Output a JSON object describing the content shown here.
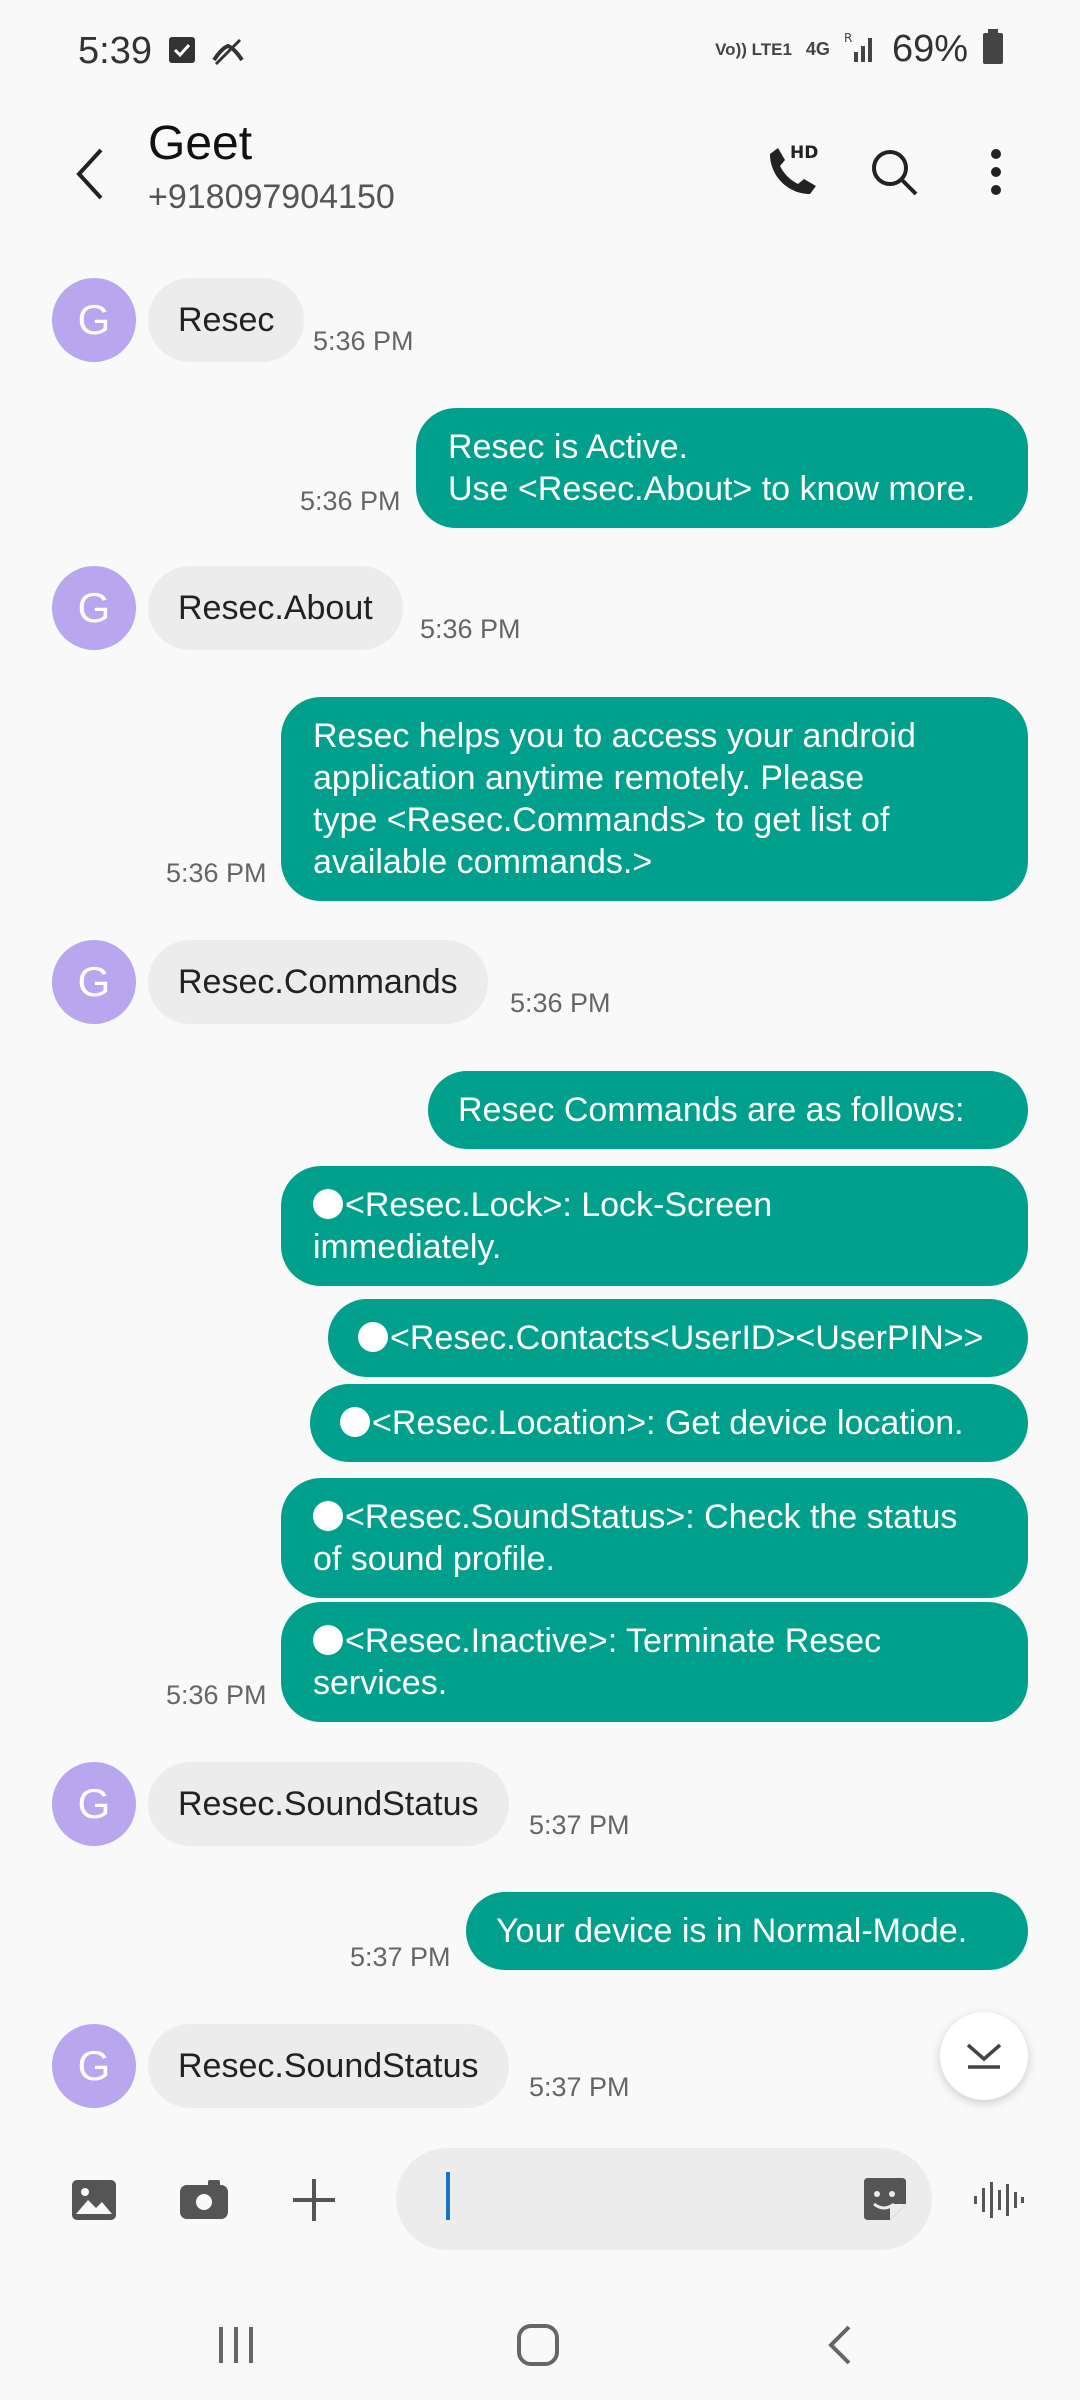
{
  "status_bar": {
    "time": "5:39",
    "volte_label": "Vo)) LTE1",
    "net_label": "4G",
    "roaming": "R",
    "battery": "69%"
  },
  "header": {
    "contact_name": "Geet",
    "contact_number": "+918097904150",
    "call_icon": "hd-call-icon",
    "call_badge": "HD",
    "search_icon": "search-icon",
    "menu_icon": "more-vert-icon"
  },
  "avatar_letter": "G",
  "messages": [
    {
      "dir": "in",
      "text": "Resec",
      "time": "5:36 PM"
    },
    {
      "dir": "out",
      "lines": [
        "Resec is Active.",
        "Use <Resec.About> to know more."
      ],
      "time": "5:36 PM"
    },
    {
      "dir": "in",
      "text": "Resec.About",
      "time": "5:36 PM"
    },
    {
      "dir": "out",
      "lines": [
        "Resec helps you to access your android",
        "application anytime remotely. Please",
        "type <Resec.Commands> to get list of",
        "available commands.>"
      ],
      "time": "5:36 PM"
    },
    {
      "dir": "in",
      "text": "Resec.Commands",
      "time": "5:36 PM"
    },
    {
      "dir": "out",
      "lines": [
        "Resec Commands are as follows:"
      ]
    },
    {
      "dir": "out",
      "lines": [
        "<Resec.Lock>: Lock-Screen",
        "immediately."
      ]
    },
    {
      "dir": "out",
      "lines": [
        "<Resec.Contacts<UserID><UserPIN>>"
      ]
    },
    {
      "dir": "out",
      "lines": [
        "<Resec.Location>: Get device location."
      ]
    },
    {
      "dir": "out",
      "lines": [
        "<Resec.SoundStatus>: Check the status",
        "of sound profile."
      ]
    },
    {
      "dir": "out",
      "lines": [
        "<Resec.Inactive>: Terminate Resec",
        "services."
      ],
      "time": "5:36 PM"
    },
    {
      "dir": "in",
      "text": "Resec.SoundStatus",
      "time": "5:37 PM"
    },
    {
      "dir": "out",
      "lines": [
        "Your device is in Normal-Mode."
      ],
      "time": "5:37 PM"
    },
    {
      "dir": "in",
      "text": "Resec.SoundStatus",
      "time": "5:37 PM"
    }
  ],
  "composer": {
    "input_value": "",
    "gallery_icon": "gallery-icon",
    "camera_icon": "camera-icon",
    "add_icon": "plus-icon",
    "sticker_icon": "sticker-icon",
    "voice_icon": "voice-wave-icon"
  },
  "colors": {
    "outgoing_bubble": "#00a08c",
    "incoming_bubble": "#ececec",
    "avatar": "#b8a6ee",
    "background": "#f9f9f9"
  }
}
